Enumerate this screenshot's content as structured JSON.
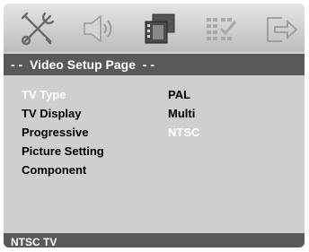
{
  "header": {
    "icons": [
      {
        "name": "tools-icon"
      },
      {
        "name": "audio-speaker-icon"
      },
      {
        "name": "video-film-icon"
      },
      {
        "name": "preference-grid-icon"
      },
      {
        "name": "exit-icon"
      }
    ]
  },
  "title": "- -  Video Setup Page  - -",
  "menu": {
    "items": [
      {
        "label": "TV Type",
        "active": true
      },
      {
        "label": "TV Display",
        "active": false
      },
      {
        "label": "Progressive",
        "active": false
      },
      {
        "label": "Picture Setting",
        "active": false
      },
      {
        "label": "Component",
        "active": false
      }
    ],
    "options": [
      {
        "label": "PAL",
        "active": false
      },
      {
        "label": "Multi",
        "active": false
      },
      {
        "label": "NTSC",
        "active": true
      }
    ]
  },
  "status": "NTSC TV",
  "colors": {
    "panel": "#cfcfcf",
    "bar": "#595959",
    "highlight_text": "#ffffff"
  }
}
